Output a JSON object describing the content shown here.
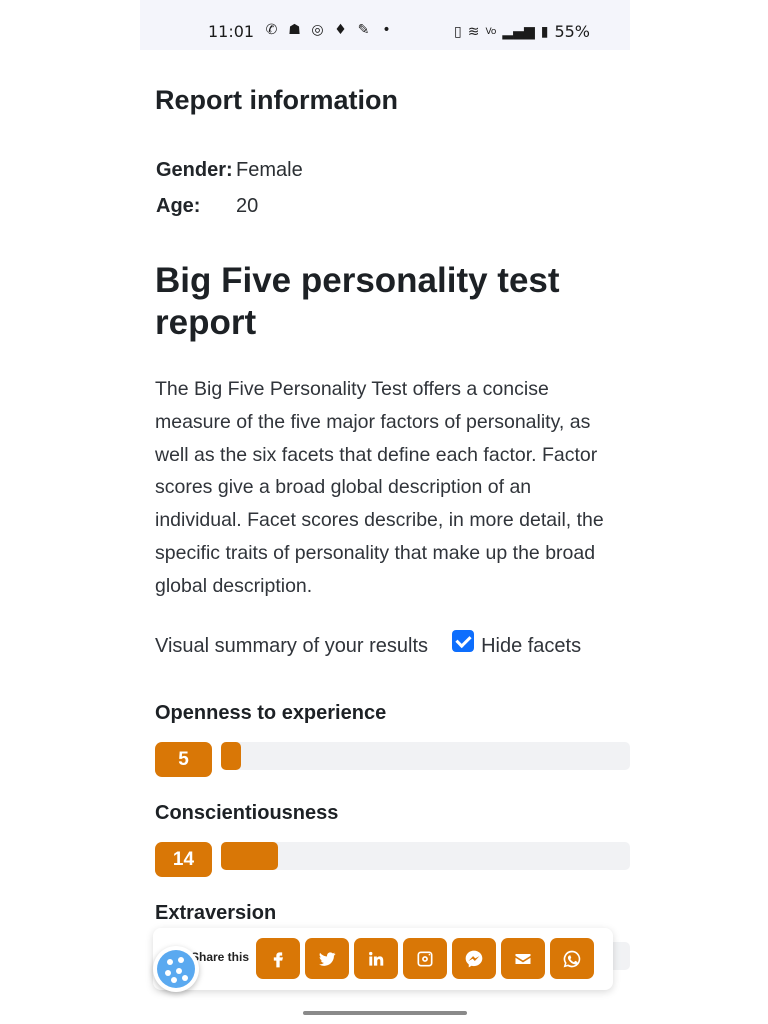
{
  "status_bar": {
    "time": "11:01",
    "left_icons": [
      "whatsapp-icon",
      "snapchat-icon",
      "instagram-icon",
      "location-icon",
      "app-icon",
      "dot-icon"
    ],
    "right_icons": [
      "vibrate-icon",
      "wifi-icon",
      "volte-icon",
      "signal-icon",
      "battery-icon"
    ],
    "battery": "55%"
  },
  "report_info": {
    "title": "Report information",
    "gender_label": "Gender:",
    "gender_value": "Female",
    "age_label": "Age:",
    "age_value": "20"
  },
  "main": {
    "title": "Big Five personality test report",
    "description": "The Big Five Personality Test offers a concise measure of the five major factors of personality, as well as the six facets that define each factor. Factor scores give a broad global description of an individual. Facet scores describe, in more detail, the specific traits of personality that make up the broad global description.",
    "summary_label": "Visual summary of your results",
    "hide_facets_label": "Hide facets",
    "hide_facets_checked": true
  },
  "factors": [
    {
      "name": "Openness to experience",
      "score": "5",
      "fraction": 0.05
    },
    {
      "name": "Conscientiousness",
      "score": "14",
      "fraction": 0.14
    },
    {
      "name": "Extraversion",
      "score": "",
      "fraction": 0.0
    }
  ],
  "share": {
    "label": "Share this",
    "buttons": [
      "facebook-icon",
      "twitter-icon",
      "linkedin-icon",
      "instagram-icon",
      "messenger-icon",
      "email-icon",
      "whatsapp-icon"
    ]
  },
  "colors": {
    "accent": "#d97706",
    "checkbox": "#0d6efd",
    "track": "#f1f2f4"
  }
}
